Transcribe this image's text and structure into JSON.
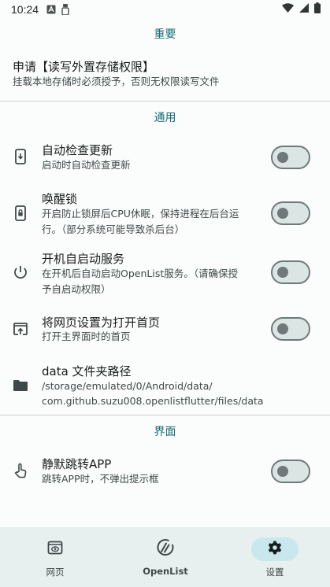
{
  "status_bar": {
    "time": "10:24"
  },
  "sections": {
    "important": "重要",
    "general": "通用",
    "interface": "界面"
  },
  "storage_permission": {
    "title": "申请【读写外置存储权限】",
    "desc": "挂载本地存储时必须授予，否则无权限读写文件"
  },
  "settings": {
    "auto_update": {
      "title": "自动检查更新",
      "desc": "启动时自动检查更新",
      "enabled": false
    },
    "wakelock": {
      "title": "唤醒锁",
      "desc_line1": "开启防止锁屏后CPU休眠，保持进程在后台运",
      "desc_line2": "行。（部分系统可能导致杀后台）",
      "enabled": false
    },
    "autostart": {
      "title": "开机自启动服务",
      "desc_line1": "在开机后自动启动OpenList服务。（请确保授",
      "desc_line2": "予自启动权限）",
      "enabled": false
    },
    "homepage": {
      "title": "将网页设置为打开首页",
      "desc": "打开主界面时的首页",
      "enabled": false
    },
    "data_folder": {
      "title": "data 文件夹路径",
      "path_line1": "/storage/emulated/0/Android/data/",
      "path_line2": "com.github.suzu008.openlistflutter/files/data"
    },
    "silent_jump": {
      "title": "静默跳转APP",
      "desc": "跳转APP时，不弹出提示框",
      "enabled": false
    }
  },
  "bottom_nav": {
    "items": [
      {
        "label": "网页",
        "icon": "web-icon",
        "active": false
      },
      {
        "label": "OpenList",
        "icon": "openlist-logo-icon",
        "active": false
      },
      {
        "label": "设置",
        "icon": "gear-icon",
        "active": true
      }
    ]
  },
  "colors": {
    "accent": "#176b74",
    "nav_background": "#e8efef",
    "active_pill": "#c8e8ee",
    "switch_track": "#dae5e4",
    "switch_outline": "#6f7979"
  }
}
